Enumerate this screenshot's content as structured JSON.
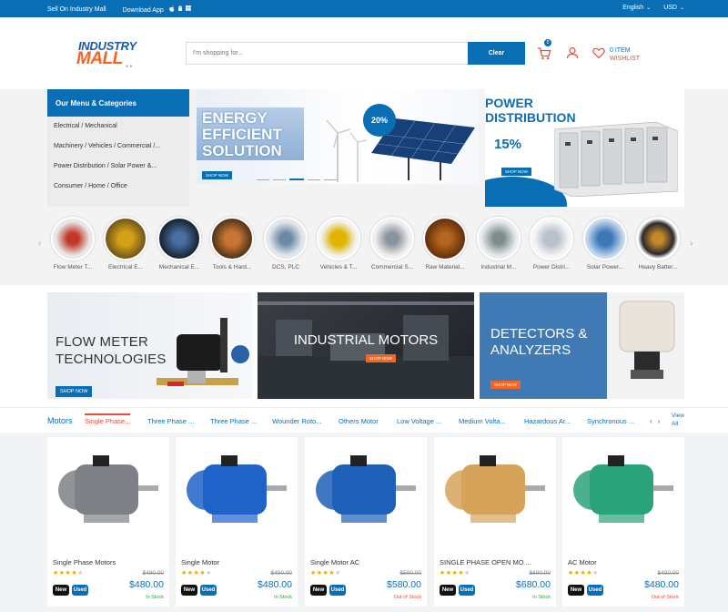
{
  "topbar": {
    "sell": "Sell On Industry Mall",
    "download": "Download App",
    "language": "English",
    "currency": "USD"
  },
  "header": {
    "logo_top": "INDUSTRY",
    "logo_bottom": "MALL",
    "search_placeholder": "I'm shopping for...",
    "search_button": "Clear",
    "cart_count": "0",
    "wishlist_count": "0 ITEM",
    "wishlist_label": "WISHLIST"
  },
  "menu": {
    "title": "Our Menu & Categories",
    "items": [
      "Electrical / Mechanical",
      "Machinery / Vehicles / Commercial /...",
      "Power Distribution / Solar Power &...",
      "Consumer / Home / Office"
    ]
  },
  "banners": {
    "energy_l1": "ENERGY",
    "energy_l2": "EFFICIENT",
    "energy_l3": "SOLUTION",
    "energy_badge": "20%",
    "energy_shop": "SHOP NOW",
    "power_l1": "POWER",
    "power_l2": "DISTRIBUTION",
    "power_off": "15%",
    "power_shop": "SHOP NOW"
  },
  "categories": [
    {
      "label": "Flow Meter T...",
      "color": "#c0392b"
    },
    {
      "label": "Electrical E...",
      "color": "#d4a017"
    },
    {
      "label": "Mechanical E...",
      "color": "#2c3e50"
    },
    {
      "label": "Tools & Hard...",
      "color": "#8e5a2b"
    },
    {
      "label": "DCS, PLC",
      "color": "#5b7083"
    },
    {
      "label": "Vehicles & T...",
      "color": "#e0b400"
    },
    {
      "label": "Commercial S...",
      "color": "#9aa3ad"
    },
    {
      "label": "Raw Material...",
      "color": "#a0522d"
    },
    {
      "label": "Industrial M...",
      "color": "#7f8c8d"
    },
    {
      "label": "Power Distri...",
      "color": "#cfd6dd"
    },
    {
      "label": "Solar Power...",
      "color": "#3d79b8"
    },
    {
      "label": "Heavy Batter...",
      "color": "#2b2b2b"
    }
  ],
  "promos": {
    "flow_l1": "FLOW METER",
    "flow_l2": "TECHNOLOGIES",
    "flow_shop": "SHOP NOW",
    "motors": "INDUSTRIAL MOTORS",
    "motors_shop": "SHOP NOW",
    "detect_l1": "DETECTORS &",
    "detect_l2": "ANALYZERS",
    "detect_shop": "SHOP NOW"
  },
  "tabs": {
    "title": "Motors",
    "items": [
      "Single Phase...",
      "Three Phase ...",
      "Three Phase ...",
      "Wounder Roto...",
      "Others Motor",
      "Low Voltage ...",
      "Medium Volta...",
      "Hazardous Ar...",
      "Synchronous ..."
    ],
    "view_l1": "View",
    "view_l2": "All"
  },
  "products": [
    {
      "name": "Single Phase Motors",
      "old": "$490.00",
      "price": "$480.00",
      "stock": "In Stock",
      "stock_color": "#2e9e44",
      "rating": 4,
      "color": "#7d8186"
    },
    {
      "name": "Single Motor",
      "old": "$490.00",
      "price": "$480.00",
      "stock": "In Stock",
      "stock_color": "#2e9e44",
      "rating": 4,
      "color": "#1f63c9"
    },
    {
      "name": "Single Motor AC",
      "old": "$590.00",
      "price": "$580.00",
      "stock": "Out of Stock",
      "stock_color": "#e74c3c",
      "rating": 4,
      "color": "#1e5fb7"
    },
    {
      "name": "SINGLE PHASE OPEN MO ...",
      "old": "$690.00",
      "price": "$680.00",
      "stock": "In Stock",
      "stock_color": "#2e9e44",
      "rating": 4,
      "color": "#d6a35a"
    },
    {
      "name": "AC Motor",
      "old": "$490.00",
      "price": "$480.00",
      "stock": "Out of Stock",
      "stock_color": "#e74c3c",
      "rating": 4,
      "color": "#2aa27a"
    }
  ],
  "tags": {
    "new": "New",
    "used": "Used"
  }
}
